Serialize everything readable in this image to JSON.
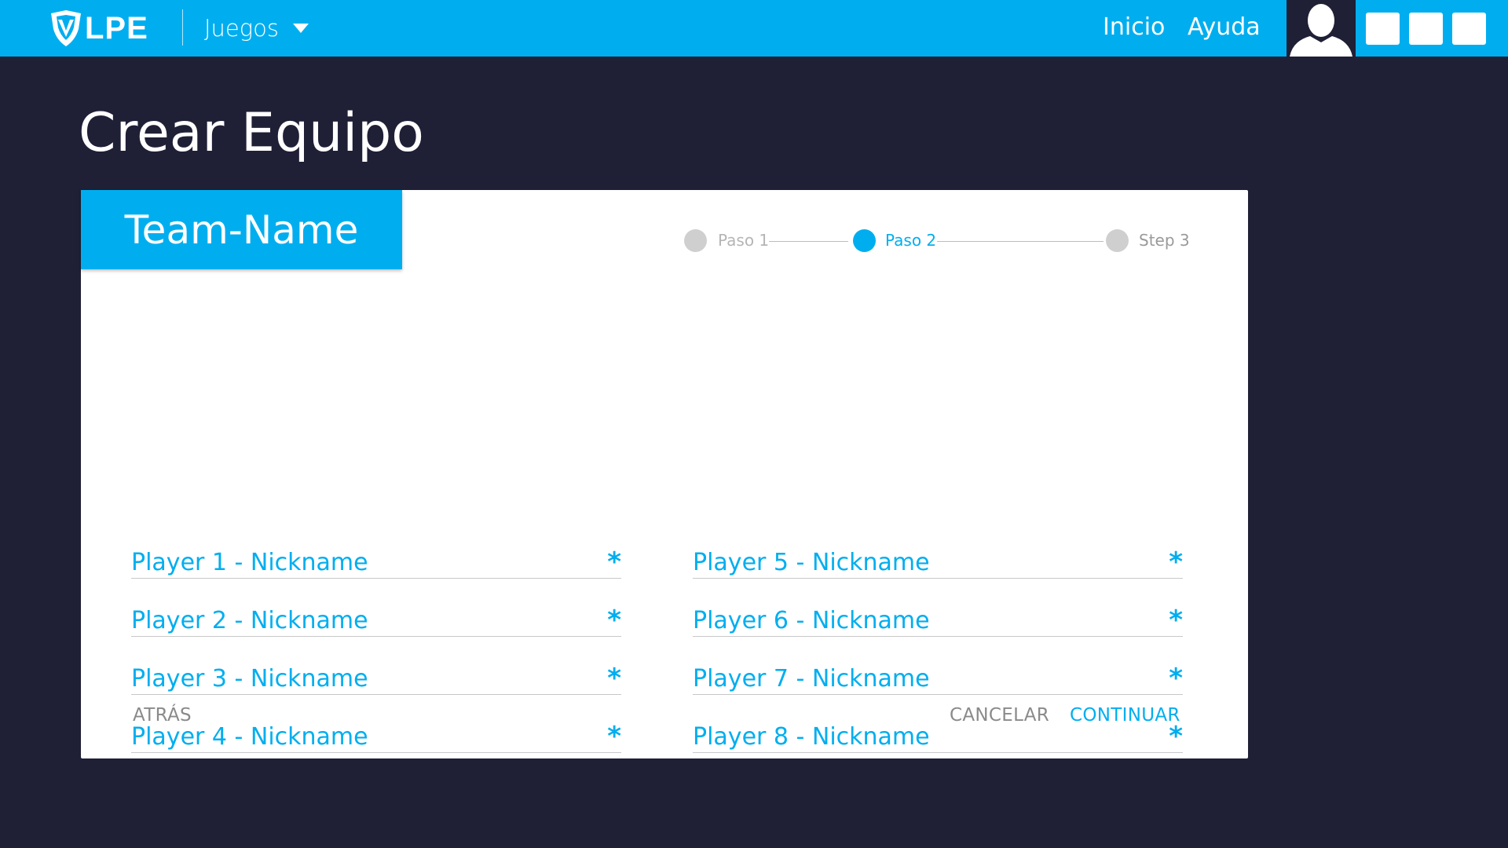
{
  "header": {
    "logo_text": "LPE",
    "games_menu_label": "Juegos",
    "links": {
      "home": "Inicio",
      "help": "Ayuda"
    },
    "brand_color": "#00aeef"
  },
  "page": {
    "title": "Crear Equipo"
  },
  "card": {
    "team_name": "Team-Name",
    "stepper": {
      "steps": [
        "Paso 1",
        "Paso 2",
        "Step 3"
      ],
      "active_step": 2
    },
    "fields": [
      {
        "placeholder": "Player 1 - Nickname",
        "required_mark": "*"
      },
      {
        "placeholder": "Player 2 - Nickname",
        "required_mark": "*"
      },
      {
        "placeholder": "Player 3 - Nickname",
        "required_mark": "*"
      },
      {
        "placeholder": "Player 4 - Nickname",
        "required_mark": "*"
      },
      {
        "placeholder": "Player 5 - Nickname",
        "required_mark": "*"
      },
      {
        "placeholder": "Player 6 - Nickname",
        "required_mark": "*"
      },
      {
        "placeholder": "Player 7 - Nickname",
        "required_mark": "*"
      },
      {
        "placeholder": "Player 8 - Nickname",
        "required_mark": "*"
      }
    ],
    "buttons": {
      "back": "ATRÁS",
      "cancel": "CANCELAR",
      "continue": "CONTINUAR"
    }
  }
}
